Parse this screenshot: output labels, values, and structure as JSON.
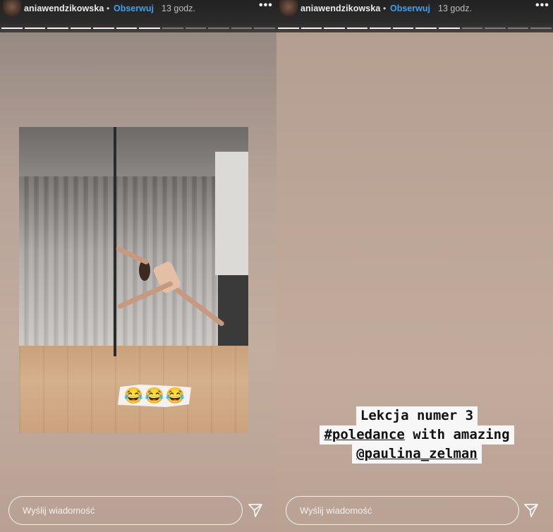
{
  "stories": [
    {
      "username": "aniawendzikowska",
      "separator": "•",
      "follow_label": "Obserwuj",
      "time_label": "13 godz.",
      "more_label": "•••",
      "progress": {
        "segments": 12,
        "completed": 7
      },
      "sticker": {
        "emojis": [
          "😂",
          "😂",
          "😂"
        ]
      },
      "reply_placeholder": "Wyślij wiadomość"
    },
    {
      "username": "aniawendzikowska",
      "separator": "•",
      "follow_label": "Obserwuj",
      "time_label": "13 godz.",
      "more_label": "•••",
      "progress": {
        "segments": 12,
        "completed": 8
      },
      "caption": {
        "line1": "Lekcja numer 3",
        "line2_hashtag": "#poledance",
        "line2_rest": " with amazing",
        "line3_mention": "@paulina_zelman"
      },
      "reply_placeholder": "Wyślij wiadomość"
    }
  ],
  "icons": {
    "send": "send-paper-plane-icon",
    "more": "more-options-icon"
  }
}
